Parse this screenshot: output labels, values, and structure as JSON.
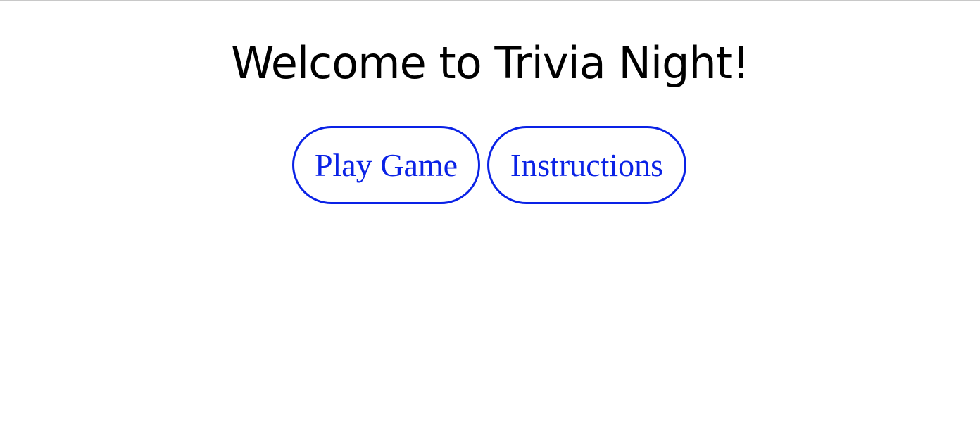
{
  "page": {
    "title": "Welcome to Trivia Night!"
  },
  "buttons": {
    "play_label": "Play Game",
    "instructions_label": "Instructions"
  },
  "colors": {
    "accent": "#0a22e6",
    "text": "#000000",
    "background": "#ffffff"
  }
}
